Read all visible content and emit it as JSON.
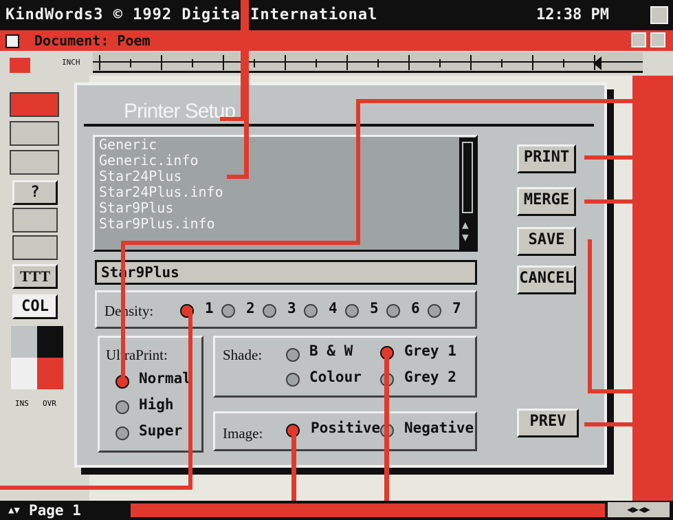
{
  "window": {
    "title": "KindWords3 © 1992 Digita International",
    "clock": "12:38 PM"
  },
  "document": {
    "title": "Document: Poem"
  },
  "ruler": {
    "unit": "INCH"
  },
  "toolbar": {
    "help": "?",
    "fonts": "TTT",
    "col": "COL",
    "ins": "INS",
    "ovr": "OVR"
  },
  "dialog": {
    "title": "Printer Setup",
    "files": [
      "Generic",
      "Generic.info",
      "Star24Plus",
      "Star24Plus.info",
      "Star9Plus",
      "Star9Plus.info"
    ],
    "selected_name": "Star9Plus",
    "density": {
      "label": "Density:",
      "options": [
        "1",
        "2",
        "3",
        "4",
        "5",
        "6",
        "7"
      ],
      "selected": "1"
    },
    "ultraprint": {
      "label": "UltraPrint:",
      "options": [
        "Normal",
        "High",
        "Super"
      ],
      "selected": "Normal"
    },
    "shade": {
      "label": "Shade:",
      "options": [
        "B & W",
        "Grey 1",
        "Colour",
        "Grey 2"
      ],
      "selected": "Grey 1"
    },
    "image": {
      "label": "Image:",
      "options": [
        "Positive",
        "Negative"
      ],
      "selected": "Positive"
    },
    "buttons": {
      "print": "PRINT",
      "merge": "MERGE",
      "save": "SAVE",
      "cancel": "CANCEL",
      "prev": "PREV"
    }
  },
  "status": {
    "page": "Page 1"
  },
  "colors": {
    "accent": "#e03a2e",
    "panel": "#bfc3c3",
    "dark": "#101010"
  }
}
